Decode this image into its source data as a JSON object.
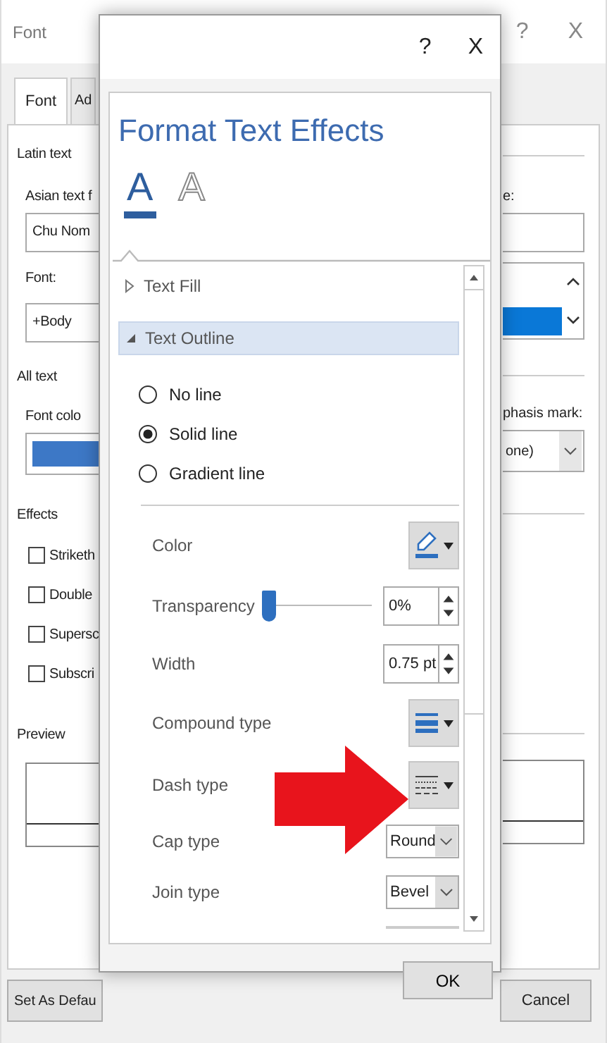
{
  "font_dialog": {
    "title": "Font",
    "help_button": "?",
    "close_button": "X",
    "tabs": [
      {
        "label": "Font",
        "selected": true
      },
      {
        "label": "Ad",
        "selected": false
      }
    ],
    "latin_text": {
      "heading": "Latin text",
      "asian_font_label": "Asian text f",
      "asian_font_value": "Chu Nom",
      "size_label": "e:",
      "font_label": "Font:",
      "font_value": "+Body"
    },
    "all_text": {
      "heading": "All text",
      "font_color_label": "Font colo",
      "emphasis_label": "phasis mark:",
      "emphasis_value": "one)"
    },
    "effects": {
      "heading": "Effects",
      "items": [
        {
          "label": "Striketh",
          "checked": false
        },
        {
          "label": "Double",
          "checked": false
        },
        {
          "label": "Supersc",
          "checked": false
        },
        {
          "label": "Subscri",
          "checked": false
        }
      ]
    },
    "preview": {
      "heading": "Preview"
    },
    "set_default_button": "Set As Defau",
    "cancel_button": "Cancel"
  },
  "format_text_effects": {
    "help_button": "?",
    "close_button": "X",
    "title": "Format Text Effects",
    "icon_tabs": [
      {
        "glyph": "A",
        "kind": "fill",
        "selected": true
      },
      {
        "glyph": "A",
        "kind": "outline",
        "selected": false
      }
    ],
    "sections": [
      {
        "label": "Text Fill",
        "expanded": false
      },
      {
        "label": "Text Outline",
        "expanded": true
      }
    ],
    "line_options": [
      {
        "label": "No line",
        "selected": false
      },
      {
        "label": "Solid line",
        "selected": true
      },
      {
        "label": "Gradient line",
        "selected": false
      }
    ],
    "properties": [
      {
        "kind": "color",
        "label": "Color"
      },
      {
        "kind": "slider",
        "label": "Transparency",
        "level": 0,
        "value": "0%"
      },
      {
        "kind": "spin",
        "label": "Width",
        "value": "0.75 pt"
      },
      {
        "kind": "compound",
        "label": "Compound type"
      },
      {
        "kind": "dash",
        "label": "Dash type"
      },
      {
        "kind": "dropdown",
        "label": "Cap type",
        "value": "Round"
      },
      {
        "kind": "dropdown",
        "label": "Join type",
        "value": "Bevel"
      }
    ],
    "ok_button": "OK"
  }
}
